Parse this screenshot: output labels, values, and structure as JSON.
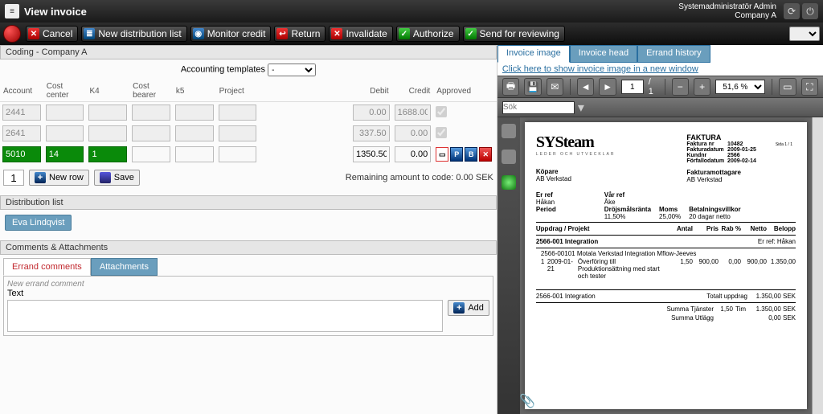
{
  "titlebar": {
    "title": "View invoice",
    "user_line1": "Systemadministratör Admin",
    "user_line2": "Company A"
  },
  "actions": {
    "cancel": "Cancel",
    "new_dist": "New distribution list",
    "monitor": "Monitor credit",
    "return": "Return",
    "invalidate": "Invalidate",
    "authorize": "Authorize",
    "send_review": "Send for reviewing"
  },
  "coding": {
    "panel": "Coding - Company A",
    "templates_label": "Accounting templates",
    "templates_value": "-",
    "cols": {
      "account": "Account",
      "cost_center": "Cost center",
      "k4": "K4",
      "cost_bearer": "Cost bearer",
      "k5": "k5",
      "project": "Project",
      "debit": "Debit",
      "credit": "Credit",
      "approved": "Approved"
    },
    "rows": [
      {
        "account": "2441",
        "cost_center": "",
        "k4": "",
        "cost_bearer": "",
        "k5": "",
        "project": "",
        "debit": "0.00",
        "credit": "1688.00",
        "approved": true,
        "readonly": true
      },
      {
        "account": "2641",
        "cost_center": "",
        "k4": "",
        "cost_bearer": "",
        "k5": "",
        "project": "",
        "debit": "337.50",
        "credit": "0.00",
        "approved": true,
        "readonly": true
      },
      {
        "account": "5010",
        "cost_center": "14",
        "k4": "1",
        "cost_bearer": "",
        "k5": "",
        "project": "",
        "debit": "1350.50",
        "credit": "0.00",
        "approved": false,
        "readonly": false,
        "active": true
      }
    ],
    "page_input": "1",
    "new_row": "New row",
    "save": "Save",
    "remaining_label": "Remaining amount to code:",
    "remaining_value": "0.00",
    "remaining_currency": "SEK"
  },
  "distribution": {
    "panel": "Distribution list",
    "people": [
      "Eva Lindqvist"
    ]
  },
  "comments": {
    "panel": "Comments & Attachments",
    "tab_errand": "Errand comments",
    "tab_attach": "Attachments",
    "new_hdr": "New errand comment",
    "text_label": "Text",
    "add": "Add"
  },
  "right": {
    "tab_image": "Invoice image",
    "tab_head": "Invoice head",
    "tab_history": "Errand history",
    "open_link": "Click here to show invoice image in a new window",
    "page_current": "1",
    "page_total": "/ 1",
    "zoom": "51,6 %",
    "search_placeholder": "Sök"
  },
  "invoice_doc": {
    "logo": "SYSteam",
    "logo_sub": "LEDER OCH UTVECKLAR",
    "faktura_title": "FAKTURA",
    "meta": {
      "faktura_nr_l": "Faktura nr",
      "faktura_nr_v": "10482",
      "fakturadatum_l": "Fakturadatum",
      "fakturadatum_v": "2009-01-25",
      "kundnr_l": "Kundnr",
      "kundnr_v": "2566",
      "forfall_l": "Förfallodatum",
      "forfall_v": "2009-02-14",
      "sida": "Sida 1 / 1"
    },
    "kopare_l": "Köpare",
    "kopare_v": "AB Verkstad",
    "mottagare_l": "Fakturamottagare",
    "mottagare_v": "AB Verkstad",
    "er_ref_l": "Er ref",
    "er_ref_v": "Håkan",
    "var_ref_l": "Vår ref",
    "var_ref_v": "Åke",
    "period_l": "Period",
    "drojsmal_l": "Dröjsmålsränta",
    "drojsmal_v": "11,50%",
    "moms_l": "Moms",
    "moms_v": "25,00%",
    "betal_l": "Betalningsvillkor",
    "betal_v": "20 dagar netto",
    "cols": {
      "uppdrag": "Uppdrag / Projekt",
      "antal": "Antal",
      "pris": "Pris",
      "rab": "Rab %",
      "netto": "Netto",
      "belopp": "Belopp"
    },
    "group_title": "2566-001 Integration",
    "group_ref": "Er ref: Håkan",
    "sub_title": "2566-00101 Motala Verkstad Integration Mflow-Jeeves",
    "line1": {
      "no": "1",
      "date": "2009-01-21",
      "desc": "Överföring till Produktionsättning med start och tester",
      "antal": "1,50",
      "pris": "900,00",
      "rab": "0,00",
      "netto": "900,00",
      "belopp": "1.350,00"
    },
    "totals": {
      "group2": "2566-001 Integration",
      "totalt_l": "Totalt uppdrag",
      "totalt_v": "1.350,00 SEK",
      "tjanster_l": "Summa Tjänster",
      "tjanster_a": "1,50",
      "tjanster_u": "Tim",
      "tjanster_v": "1.350,00 SEK",
      "utlagg_l": "Summa Utlägg",
      "utlagg_v": "0,00 SEK"
    }
  }
}
